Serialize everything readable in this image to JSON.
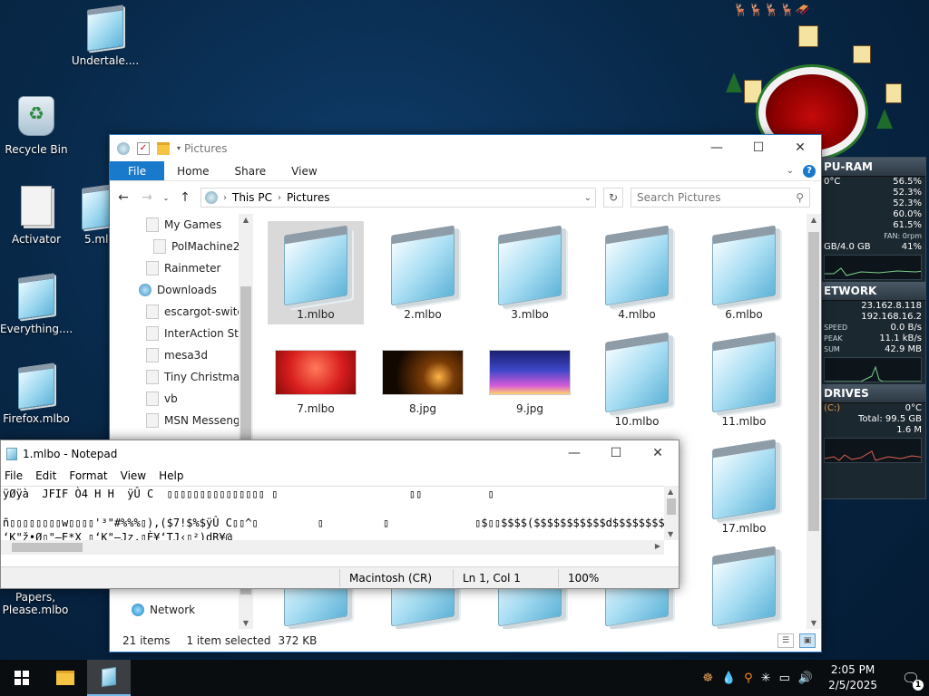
{
  "desktop": {
    "icons": [
      {
        "label": "Undertale...."
      },
      {
        "label": "Recycle Bin"
      },
      {
        "label": "Activator"
      },
      {
        "label": "5.mlb"
      },
      {
        "label": "Everything...."
      },
      {
        "label": "Firefox.mlbo"
      },
      {
        "label": "Papers, Please.mlbo"
      }
    ]
  },
  "sysmon": {
    "cpu_title": "PU-RAM",
    "temp": "0°C",
    "cpu_pct": "56.5%",
    "cores": [
      "52.3%",
      "52.3%",
      "60.0%",
      "61.5%"
    ],
    "fan": "FAN: 0rpm",
    "ram": "GB/4.0 GB",
    "ram_pct": "41%",
    "net_title": "ETWORK",
    "ip1": "23.162.8.118",
    "ip2": "192.168.16.2",
    "speed_label": "SPEED",
    "speed_val": "0.0 B/s",
    "peak_label": "PEAK",
    "peak_val": "11.1 kB/s",
    "sum_label": "SUM",
    "sum_val": "42.9 MB",
    "drives_title": "DRIVES",
    "drive_name": "(C:)",
    "drive_temp": "0°C",
    "drive_total": "Total: 99.5 GB",
    "drive_used": "1.6 M"
  },
  "explorer": {
    "title": "Pictures",
    "tabs": {
      "file": "File",
      "home": "Home",
      "share": "Share",
      "view": "View"
    },
    "address": {
      "root": "This PC",
      "folder": "Pictures"
    },
    "search_placeholder": "Search Pictures",
    "nav_items": [
      {
        "label": "My Games"
      },
      {
        "label": "PolMachine2"
      },
      {
        "label": "Rainmeter"
      },
      {
        "label": "Downloads"
      },
      {
        "label": "escargot-switc"
      },
      {
        "label": "InterAction Stu"
      },
      {
        "label": "mesa3d"
      },
      {
        "label": "Tiny Christmas"
      },
      {
        "label": "vb"
      },
      {
        "label": "MSN Messeng"
      },
      {
        "label": "Network"
      }
    ],
    "files": [
      {
        "name": "1.mlbo"
      },
      {
        "name": "2.mlbo"
      },
      {
        "name": "3.mlbo"
      },
      {
        "name": "4.mlbo"
      },
      {
        "name": "6.mlbo"
      },
      {
        "name": "7.mlbo"
      },
      {
        "name": "8.jpg"
      },
      {
        "name": "9.jpg"
      },
      {
        "name": "10.mlbo"
      },
      {
        "name": "11.mlbo"
      },
      {
        "name": "17.mlbo"
      }
    ],
    "status": {
      "count": "21 items",
      "selected": "1 item selected",
      "size": "372 KB"
    }
  },
  "notepad": {
    "title": "1.mlbo - Notepad",
    "menu": {
      "file": "File",
      "edit": "Edit",
      "format": "Format",
      "view": "View",
      "help": "Help"
    },
    "lines": [
      "ÿØÿà  JFIF Ò4 H H  ÿÛ C  ▯▯▯▯▯▯▯▯▯▯▯▯▯▯▯ ▯                    ▯▯          ▯",
      "",
      "ñ▯▯▯▯▯▯▯▯w▯▯▯▯'³\"#%%%▯),($7!$%$ÿÛ C▯▯^▯         ▯         ▯             ▯$▯▯$$$$($$$$$$$$$$$d$$$$$$$$",
      "‘K\"ž•Ø▯\"—E*X ▯‘K\"—Jz,▯È¥‘TJ‹▯²)dR¥@"
    ],
    "status": {
      "encoding": "Macintosh (CR)",
      "position": "Ln 1, Col 1",
      "zoom": "100%"
    }
  },
  "taskbar": {
    "time": "2:05 PM",
    "date": "2/5/2025",
    "notif_count": "1"
  }
}
